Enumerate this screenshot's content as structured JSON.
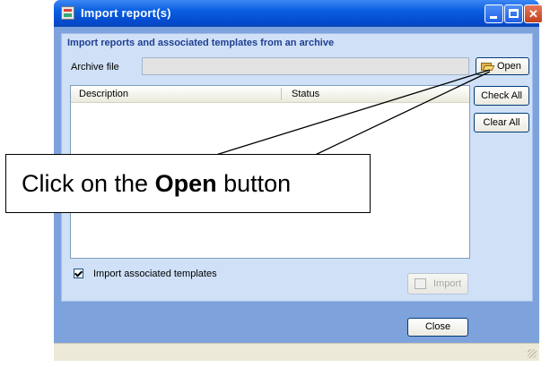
{
  "window": {
    "title": "Import report(s)",
    "heading": "Import reports and associated templates from an archive"
  },
  "archive": {
    "label": "Archive file",
    "value": "",
    "open_label": "Open"
  },
  "list": {
    "columns": [
      "Description",
      "Status"
    ],
    "rows": []
  },
  "side_buttons": {
    "check_all": "Check All",
    "clear_all": "Clear All"
  },
  "options": {
    "import_templates_label": "Import associated templates",
    "import_templates_checked": true
  },
  "footer": {
    "import_label": "Import",
    "close_label": "Close"
  },
  "callout": {
    "prefix": "Click on the ",
    "emphasis": "Open",
    "suffix": " button"
  },
  "icons": {
    "title": "report-import-icon",
    "open": "folder-open-icon",
    "import": "import-icon"
  }
}
